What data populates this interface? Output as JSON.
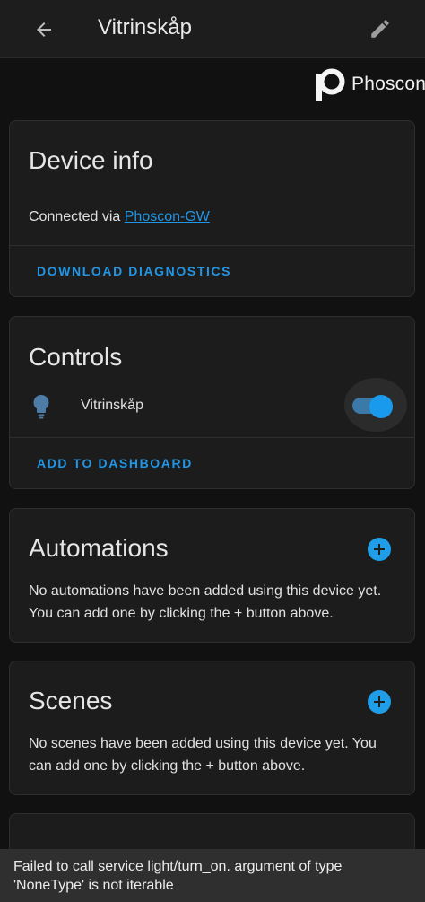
{
  "header": {
    "title": "Vitrinskåp",
    "back_icon": "arrow-left-icon",
    "edit_icon": "pencil-icon"
  },
  "brand": {
    "name": "Phoscon",
    "logo_icon": "phoscon-logo-icon"
  },
  "device_info": {
    "title": "Device info",
    "connected_prefix": "Connected via",
    "connected_link": "Phoscon-GW",
    "action": "DOWNLOAD DIAGNOSTICS"
  },
  "controls": {
    "title": "Controls",
    "entity_icon": "lightbulb-icon",
    "entity_name": "Vitrinskåp",
    "toggle_state": "on",
    "action": "ADD TO DASHBOARD"
  },
  "automations": {
    "title": "Automations",
    "empty_text": "No automations have been added using this device yet. You can add one by clicking the + button above.",
    "add_icon": "plus-circle-icon"
  },
  "scenes": {
    "title": "Scenes",
    "empty_text": "No scenes have been added using this device yet. You can add one by clicking the + button above.",
    "add_icon": "plus-circle-icon"
  },
  "snackbar": {
    "message": "Failed to call service light/turn_on. argument of type 'NoneType' is not iterable"
  },
  "colors": {
    "accent": "#2196e6",
    "background": "#111111",
    "card": "#1c1c1c"
  }
}
